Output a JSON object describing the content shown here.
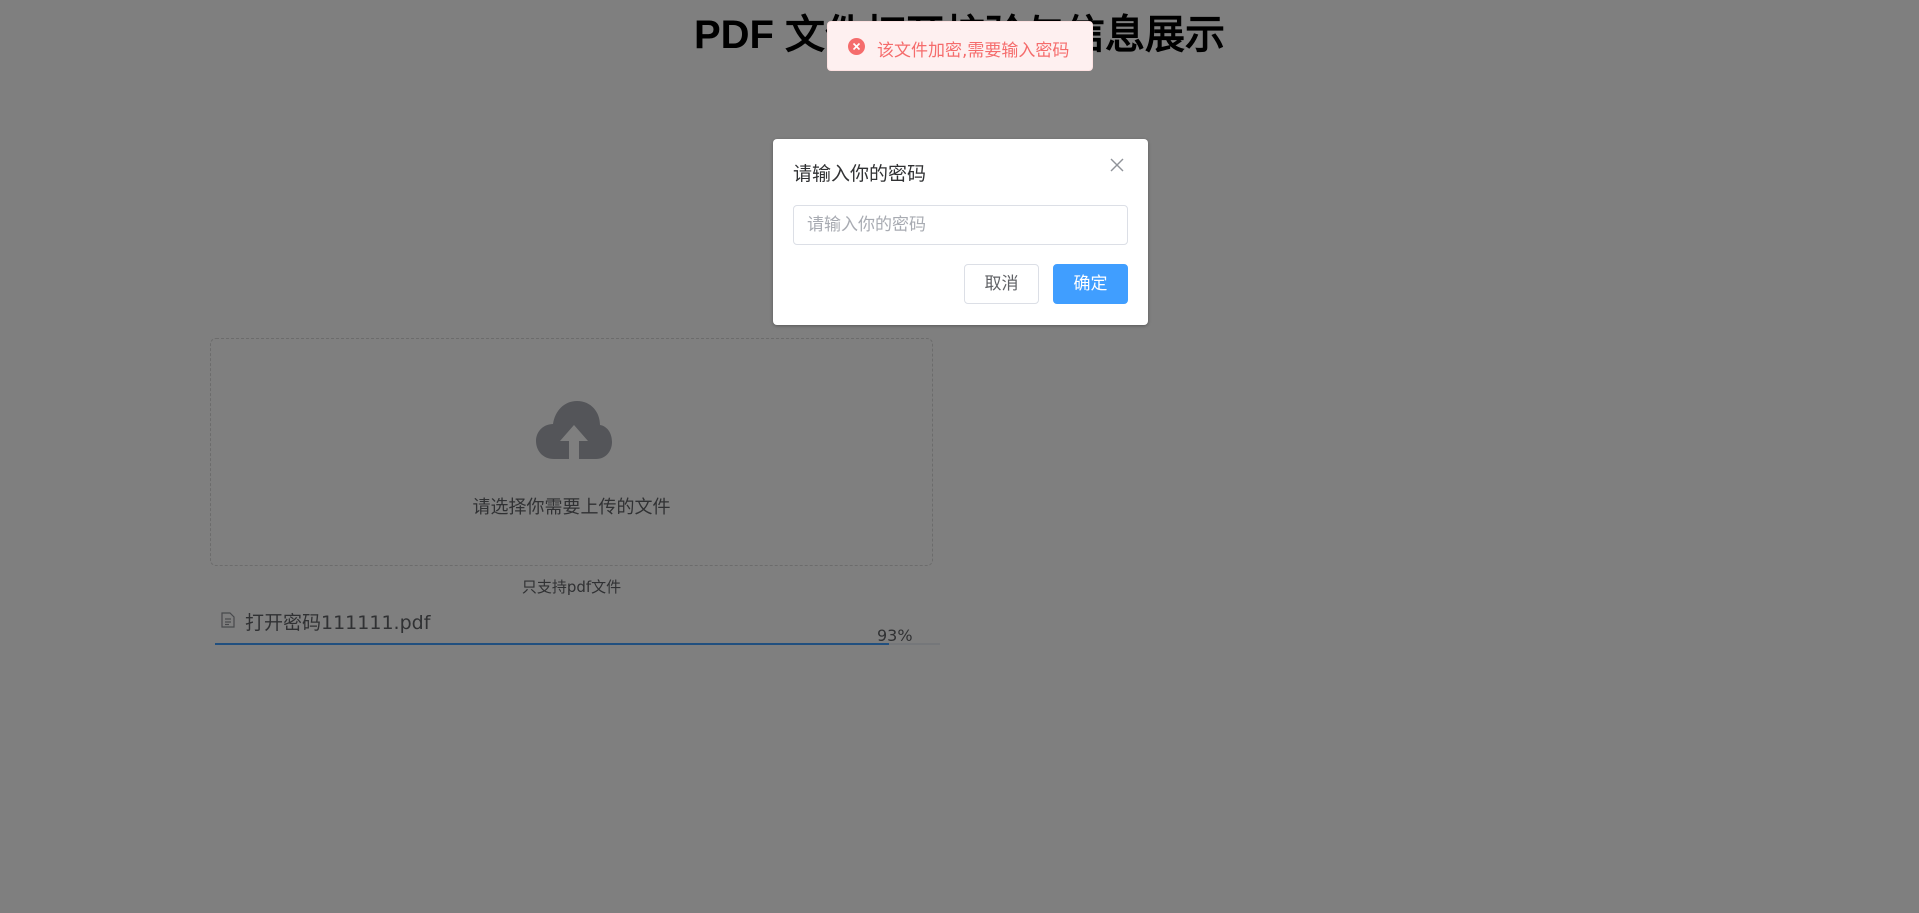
{
  "page": {
    "title": "PDF 文件打开校验与信息展示"
  },
  "upload": {
    "prompt": "请选择你需要上传的文件",
    "tip": "只支持pdf文件",
    "icon": "cloud-upload-icon"
  },
  "file": {
    "name": "打开密码111111.pdf",
    "icon": "document-icon",
    "progress_percent": 93,
    "progress_label": "93%"
  },
  "dialog": {
    "title": "请输入你的密码",
    "input_placeholder": "请输入你的密码",
    "input_value": "",
    "cancel_label": "取消",
    "confirm_label": "确定",
    "close_icon": "close-icon"
  },
  "message": {
    "type": "error",
    "text": "该文件加密,需要输入密码",
    "icon": "error-circle-icon"
  },
  "colors": {
    "primary": "#409eff",
    "error": "#f56c6c",
    "error_bg": "#fef0f0",
    "overlay": "rgba(0,0,0,0.5)",
    "text_regular": "#606266"
  }
}
